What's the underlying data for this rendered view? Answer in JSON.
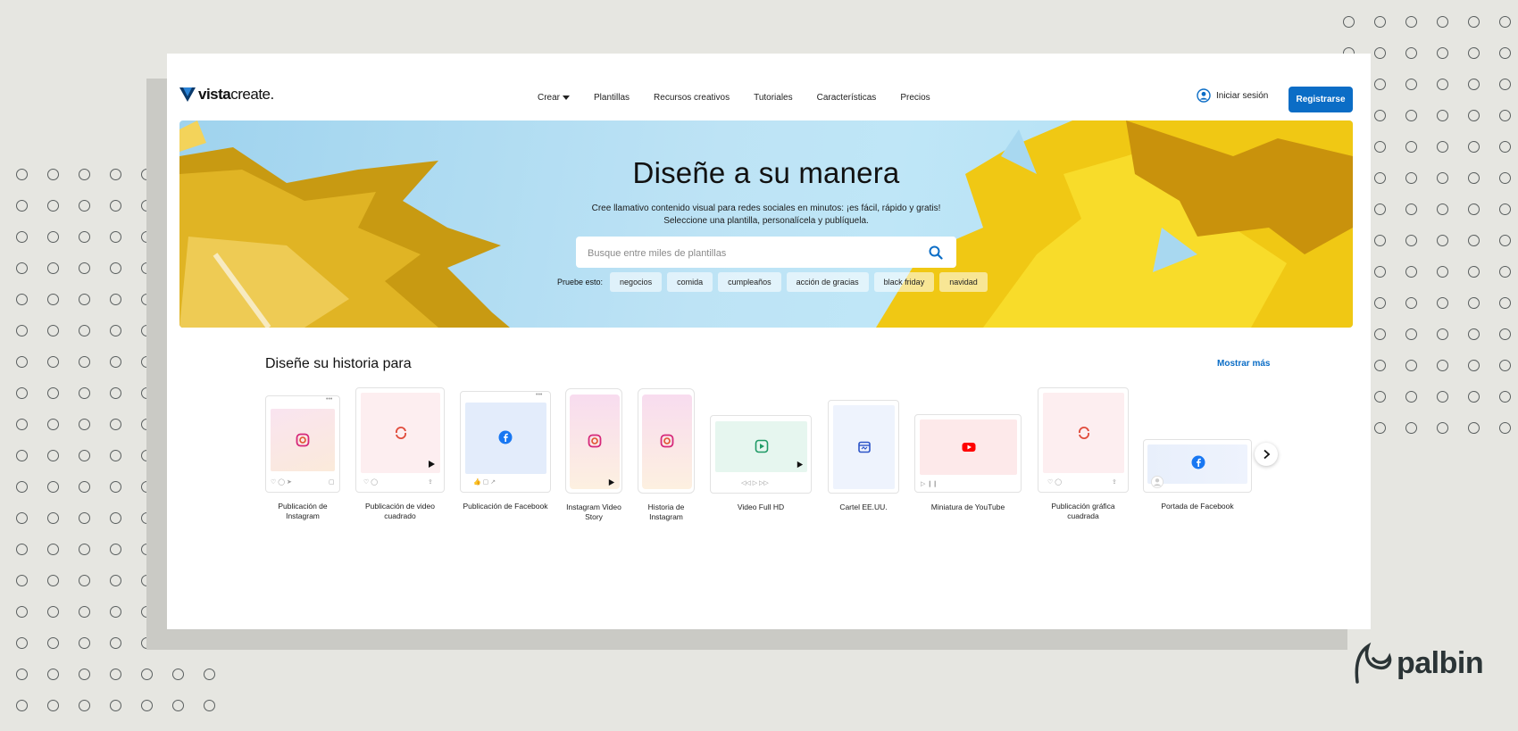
{
  "brand": {
    "logo_bold": "vista",
    "logo_light": "create.",
    "accent": "#0b6dc6"
  },
  "nav": {
    "items": [
      "Crear",
      "Plantillas",
      "Recursos creativos",
      "Tutoriales",
      "Características",
      "Precios"
    ],
    "login": "Iniciar sesión",
    "register": "Registrarse"
  },
  "hero": {
    "title": "Diseñe a su manera",
    "subtitle_line1": "Cree llamativo contenido visual para redes sociales en minutos: ¡es fácil, rápido y gratis!",
    "subtitle_line2": "Seleccione una plantilla, personalícela y publíquela.",
    "search_placeholder": "Busque entre miles de plantillas",
    "try_label": "Pruebe esto:",
    "chips": [
      "negocios",
      "comida",
      "cumpleaños",
      "acción de gracias",
      "black friday",
      "navidad"
    ]
  },
  "section": {
    "title": "Diseñe su historia para",
    "more": "Mostrar más",
    "tiles": [
      {
        "label": "Publicación de Instagram",
        "icon": "instagram-icon"
      },
      {
        "label": "Publicación de video cuadrado",
        "icon": "refresh-icon"
      },
      {
        "label": "Publicación de Facebook",
        "icon": "facebook-icon"
      },
      {
        "label": "Instagram Video Story",
        "icon": "instagram-icon"
      },
      {
        "label": "Historia de Instagram",
        "icon": "instagram-icon"
      },
      {
        "label": "Video Full HD",
        "icon": "play-icon"
      },
      {
        "label": "Cartel EE.UU.",
        "icon": "poster-icon"
      },
      {
        "label": "Miniatura de YouTube",
        "icon": "youtube-icon"
      },
      {
        "label": "Publicación gráfica cuadrada",
        "icon": "refresh-icon"
      },
      {
        "label": "Portada de Facebook",
        "icon": "facebook-icon"
      }
    ]
  },
  "watermark": {
    "text": "palbin"
  }
}
